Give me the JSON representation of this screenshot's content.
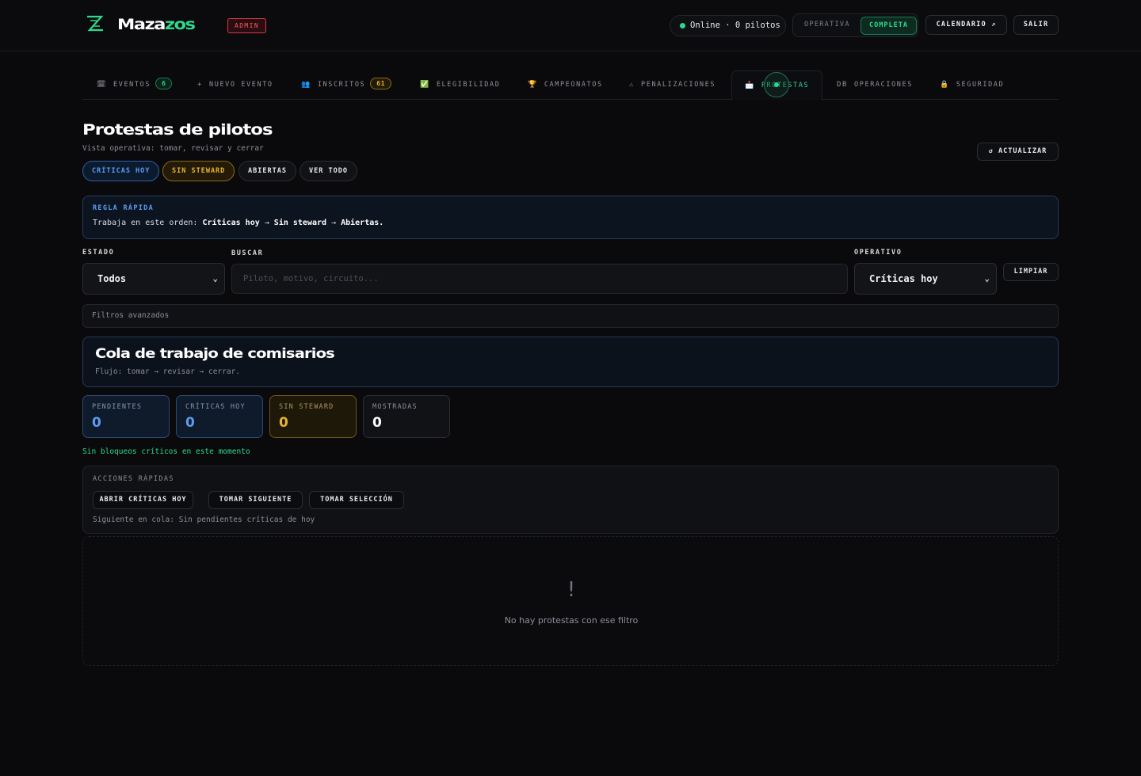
{
  "header": {
    "logo_main": "Maza",
    "logo_accent": "zos",
    "badge": "ADMIN",
    "online_status": "Online · 0 pilotos",
    "mode_inactive": "OPERATIVA",
    "mode_active": "COMPLETA",
    "calendar_button": "CALENDARIO ↗",
    "logout_button": "SALIR"
  },
  "tabs": [
    {
      "icon": "🗓",
      "label": "EVENTOS",
      "count": "6"
    },
    {
      "icon": "+",
      "label": "NUEVO EVENTO"
    },
    {
      "icon": "👥",
      "label": "INSCRITOS",
      "count": "61"
    },
    {
      "icon": "✅",
      "label": "ELEGIBILIDAD"
    },
    {
      "icon": "🏆",
      "label": "CAMPEONATOS"
    },
    {
      "icon": "⚠",
      "label": "PENALIZACIONES"
    },
    {
      "icon": "📩",
      "label": "PROTESTAS",
      "active": true
    },
    {
      "icon": "DB",
      "label": "OPERACIONES"
    },
    {
      "icon": "🔒",
      "label": "SEGURIDAD"
    }
  ],
  "page": {
    "title": "Protestas de pilotos",
    "subtitle": "Vista operativa: tomar, revisar y cerrar",
    "refresh_button": "↺ ACTUALIZAR",
    "chips": [
      "CRÍTICAS HOY",
      "SIN STEWARD",
      "ABIERTAS",
      "VER TODO"
    ]
  },
  "rule": {
    "title": "REGLA RÁPIDA",
    "prefix": "Trabaja en este orden: ",
    "step1": "Críticas hoy",
    "arrow": " → ",
    "step2": "Sin steward",
    "step3": "Abiertas."
  },
  "filters": {
    "estado_label": "ESTADO",
    "estado_value": "Todos",
    "buscar_label": "BUSCAR",
    "buscar_placeholder": "Piloto, motivo, circuito...",
    "operativo_label": "OPERATIVO",
    "operativo_value": "Críticas hoy",
    "clear_button": "LIMPIAR",
    "advanced": "Filtros avanzados"
  },
  "queue": {
    "title": "Cola de trabajo de comisarios",
    "subtitle": "Flujo: tomar → revisar → cerrar."
  },
  "stats": [
    {
      "label": "PENDIENTES",
      "value": "0"
    },
    {
      "label": "CRÍTICAS HOY",
      "value": "0"
    },
    {
      "label": "SIN STEWARD",
      "value": "0"
    },
    {
      "label": "MOSTRADAS",
      "value": "0"
    }
  ],
  "no_blockers": "Sin bloqueos críticos en este momento",
  "quick_actions": {
    "title": "ACCIONES RÁPIDAS",
    "buttons": [
      "ABRIR CRÍTICAS HOY",
      "TOMAR SIGUIENTE",
      "TOMAR SELECCIÓN"
    ],
    "next_in_queue": "Siguiente en cola: Sin pendientes críticas de hoy"
  },
  "empty": {
    "icon": "!",
    "text": "No hay protestas con ese filtro"
  },
  "colors": {
    "accent": "#2dd98f",
    "blue": "#5b9cf2",
    "yellow": "#e8b530",
    "danger": "#ff5560"
  }
}
